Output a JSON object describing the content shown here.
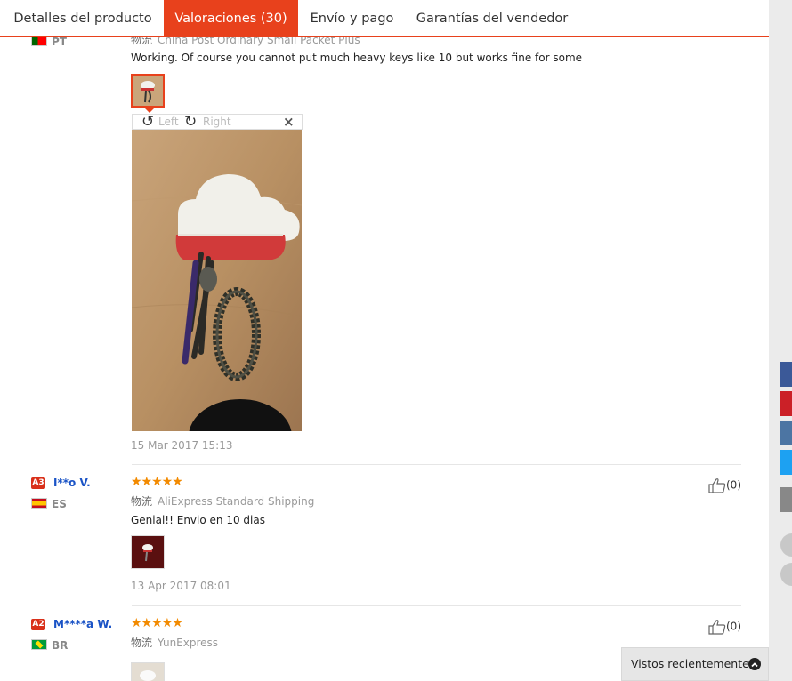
{
  "tabs": [
    {
      "label": "Detalles del producto"
    },
    {
      "label": "Valoraciones (30)"
    },
    {
      "label": "Envío y pago"
    },
    {
      "label": "Garantías del vendedor"
    }
  ],
  "shipping_label": "物流",
  "reviews": [
    {
      "country": "PT",
      "shipping": "China Post Ordinary Small Packet Plus",
      "text": "Working. Of course you cannot put much heavy keys like 10 but works fine for some",
      "date": "15 Mar 2017 15:13"
    },
    {
      "level": "A3",
      "user": "I**o V.",
      "country": "ES",
      "stars": "★★★★★",
      "shipping": "AliExpress Standard Shipping",
      "text": "Genial!! Envio en 10 dias",
      "date": "13 Apr 2017 08:01",
      "likes": "(0)"
    },
    {
      "level": "A2",
      "user": "M****a W.",
      "country": "BR",
      "stars": "★★★★★",
      "shipping": "YunExpress",
      "likes": "(0)"
    }
  ],
  "viewer": {
    "rotate_left": "Left",
    "rotate_right": "Right",
    "close": "×"
  },
  "recently_viewed": "Vistos recientemente",
  "colors": {
    "accent": "#e8411c",
    "link": "#1a53c6",
    "star": "#f28a00",
    "facebook": "#3b5998",
    "pinterest": "#cb2027",
    "vk": "#4c75a3",
    "twitter": "#1da1f2"
  },
  "icons": [
    "thumbs-up-icon",
    "rotate-left-icon",
    "rotate-right-icon",
    "close-icon",
    "chevron-up-icon",
    "facebook-icon",
    "pinterest-icon",
    "vk-icon",
    "twitter-icon",
    "share-icon"
  ]
}
